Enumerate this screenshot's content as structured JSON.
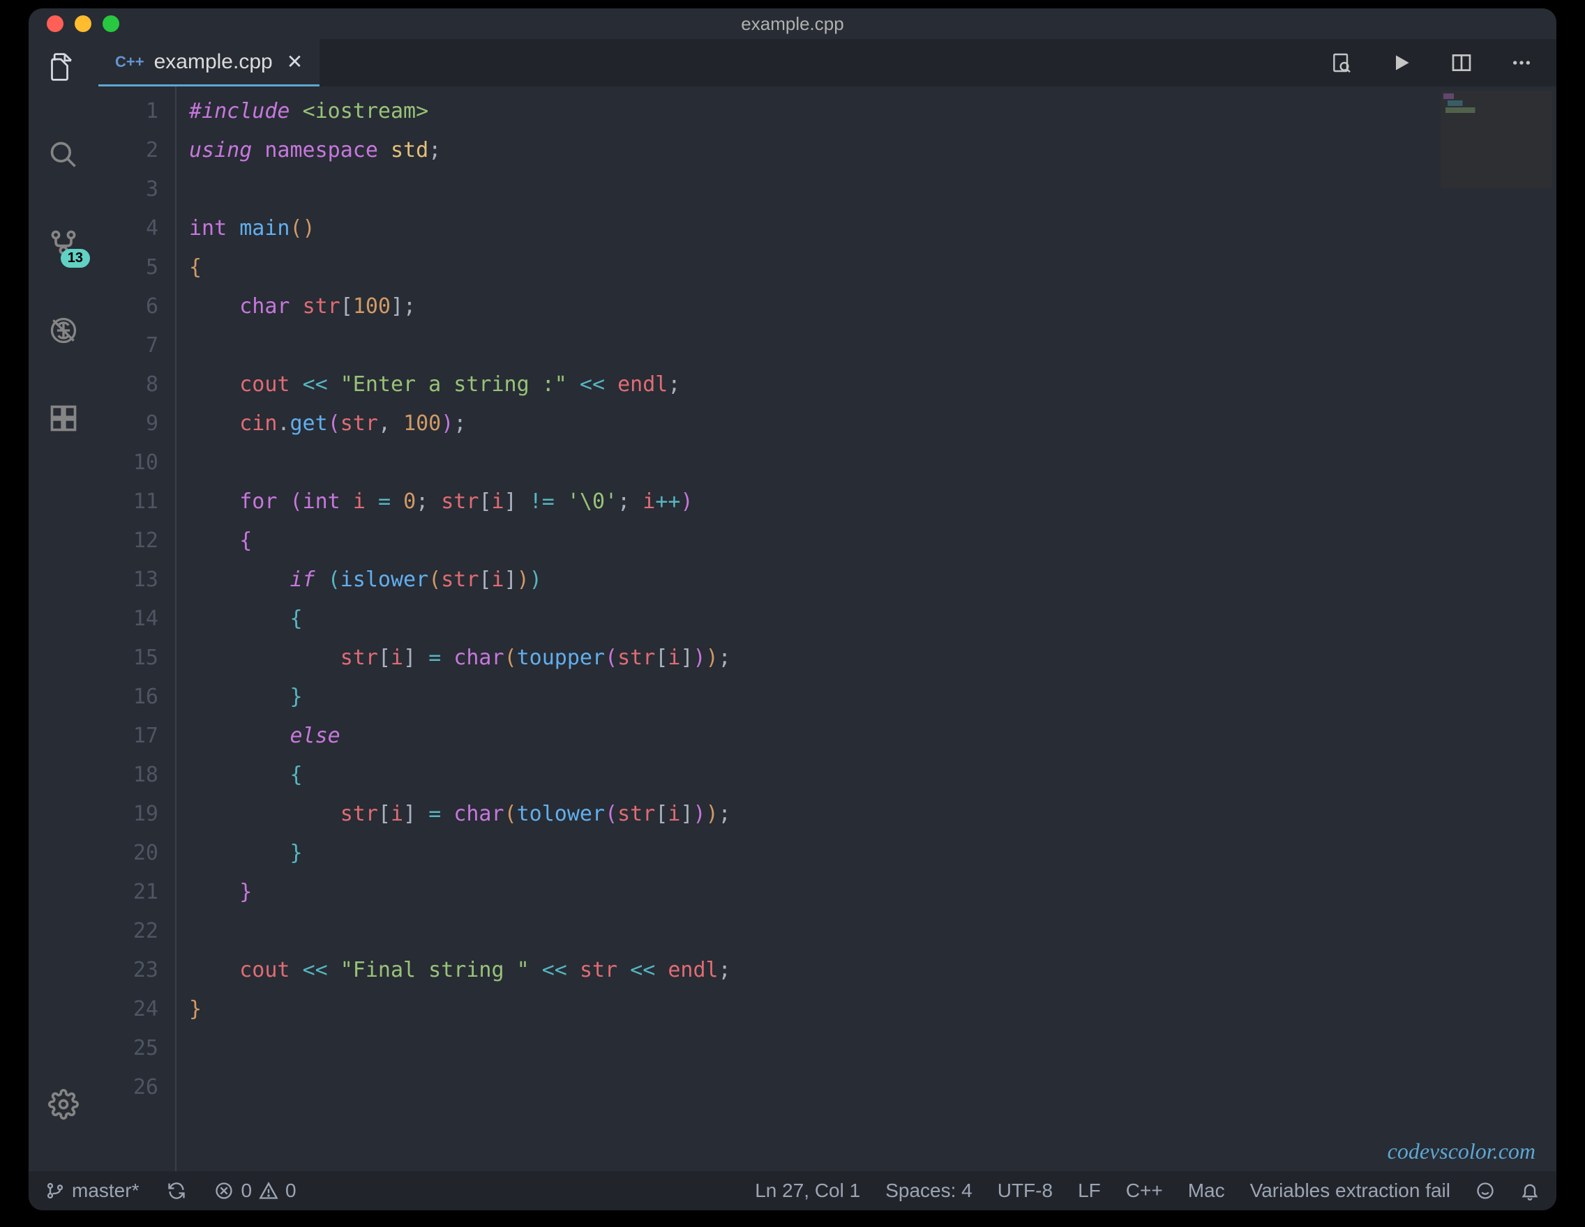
{
  "window": {
    "title": "example.cpp"
  },
  "tab": {
    "lang_icon": "C++",
    "filename": "example.cpp"
  },
  "activitybar": {
    "scm_badge": "13"
  },
  "code": {
    "lines": 26,
    "tokens": [
      [
        [
          "kw",
          "#include "
        ],
        [
          "inc",
          "<iostream>"
        ]
      ],
      [
        [
          "kw",
          "using "
        ],
        [
          "kw2",
          "namespace "
        ],
        [
          "ns",
          "std"
        ],
        [
          "punct",
          ";"
        ]
      ],
      [],
      [
        [
          "type",
          "int "
        ],
        [
          "fn",
          "main"
        ],
        [
          "brace1",
          "()"
        ]
      ],
      [
        [
          "brace1",
          "{"
        ]
      ],
      [
        [
          "punct",
          "    "
        ],
        [
          "type",
          "char "
        ],
        [
          "var",
          "str"
        ],
        [
          "punct",
          "["
        ],
        [
          "num",
          "100"
        ],
        [
          "punct",
          "];"
        ]
      ],
      [],
      [
        [
          "punct",
          "    "
        ],
        [
          "var",
          "cout"
        ],
        [
          "punct",
          " "
        ],
        [
          "op",
          "<<"
        ],
        [
          "punct",
          " "
        ],
        [
          "str",
          "\"Enter a string :\""
        ],
        [
          "punct",
          " "
        ],
        [
          "op",
          "<<"
        ],
        [
          "punct",
          " "
        ],
        [
          "var",
          "endl"
        ],
        [
          "punct",
          ";"
        ]
      ],
      [
        [
          "punct",
          "    "
        ],
        [
          "var",
          "cin"
        ],
        [
          "punct",
          "."
        ],
        [
          "fn",
          "get"
        ],
        [
          "brace2",
          "("
        ],
        [
          "var",
          "str"
        ],
        [
          "punct",
          ", "
        ],
        [
          "num",
          "100"
        ],
        [
          "brace2",
          ")"
        ],
        [
          "punct",
          ";"
        ]
      ],
      [],
      [
        [
          "punct",
          "    "
        ],
        [
          "kw2",
          "for "
        ],
        [
          "brace2",
          "("
        ],
        [
          "type",
          "int "
        ],
        [
          "var",
          "i"
        ],
        [
          "punct",
          " "
        ],
        [
          "op",
          "="
        ],
        [
          "punct",
          " "
        ],
        [
          "num",
          "0"
        ],
        [
          "punct",
          "; "
        ],
        [
          "var",
          "str"
        ],
        [
          "punct",
          "["
        ],
        [
          "var",
          "i"
        ],
        [
          "punct",
          "] "
        ],
        [
          "op",
          "!="
        ],
        [
          "punct",
          " "
        ],
        [
          "str",
          "'\\0'"
        ],
        [
          "punct",
          "; "
        ],
        [
          "var",
          "i"
        ],
        [
          "op",
          "++"
        ],
        [
          "brace2",
          ")"
        ]
      ],
      [
        [
          "punct",
          "    "
        ],
        [
          "brace2",
          "{"
        ]
      ],
      [
        [
          "punct",
          "        "
        ],
        [
          "kw",
          "if "
        ],
        [
          "brace3",
          "("
        ],
        [
          "fn",
          "islower"
        ],
        [
          "brace1",
          "("
        ],
        [
          "var",
          "str"
        ],
        [
          "punct",
          "["
        ],
        [
          "var",
          "i"
        ],
        [
          "punct",
          "]"
        ],
        [
          "brace1",
          ")"
        ],
        [
          "brace3",
          ")"
        ]
      ],
      [
        [
          "punct",
          "        "
        ],
        [
          "brace3",
          "{"
        ]
      ],
      [
        [
          "punct",
          "            "
        ],
        [
          "var",
          "str"
        ],
        [
          "punct",
          "["
        ],
        [
          "var",
          "i"
        ],
        [
          "punct",
          "] "
        ],
        [
          "op",
          "="
        ],
        [
          "punct",
          " "
        ],
        [
          "type",
          "char"
        ],
        [
          "brace1",
          "("
        ],
        [
          "fn",
          "toupper"
        ],
        [
          "brace2",
          "("
        ],
        [
          "var",
          "str"
        ],
        [
          "punct",
          "["
        ],
        [
          "var",
          "i"
        ],
        [
          "punct",
          "]"
        ],
        [
          "brace2",
          ")"
        ],
        [
          "brace1",
          ")"
        ],
        [
          "punct",
          ";"
        ]
      ],
      [
        [
          "punct",
          "        "
        ],
        [
          "brace3",
          "}"
        ]
      ],
      [
        [
          "punct",
          "        "
        ],
        [
          "kw",
          "else"
        ]
      ],
      [
        [
          "punct",
          "        "
        ],
        [
          "brace3",
          "{"
        ]
      ],
      [
        [
          "punct",
          "            "
        ],
        [
          "var",
          "str"
        ],
        [
          "punct",
          "["
        ],
        [
          "var",
          "i"
        ],
        [
          "punct",
          "] "
        ],
        [
          "op",
          "="
        ],
        [
          "punct",
          " "
        ],
        [
          "type",
          "char"
        ],
        [
          "brace1",
          "("
        ],
        [
          "fn",
          "tolower"
        ],
        [
          "brace2",
          "("
        ],
        [
          "var",
          "str"
        ],
        [
          "punct",
          "["
        ],
        [
          "var",
          "i"
        ],
        [
          "punct",
          "]"
        ],
        [
          "brace2",
          ")"
        ],
        [
          "brace1",
          ")"
        ],
        [
          "punct",
          ";"
        ]
      ],
      [
        [
          "punct",
          "        "
        ],
        [
          "brace3",
          "}"
        ]
      ],
      [
        [
          "punct",
          "    "
        ],
        [
          "brace2",
          "}"
        ]
      ],
      [],
      [
        [
          "punct",
          "    "
        ],
        [
          "var",
          "cout"
        ],
        [
          "punct",
          " "
        ],
        [
          "op",
          "<<"
        ],
        [
          "punct",
          " "
        ],
        [
          "str",
          "\"Final string \""
        ],
        [
          "punct",
          " "
        ],
        [
          "op",
          "<<"
        ],
        [
          "punct",
          " "
        ],
        [
          "var",
          "str"
        ],
        [
          "punct",
          " "
        ],
        [
          "op",
          "<<"
        ],
        [
          "punct",
          " "
        ],
        [
          "var",
          "endl"
        ],
        [
          "punct",
          ";"
        ]
      ],
      [
        [
          "brace1",
          "}"
        ]
      ],
      [],
      []
    ]
  },
  "watermark": "codevscolor.com",
  "statusbar": {
    "branch": "master*",
    "errors": "0",
    "warnings": "0",
    "cursor": "Ln 27, Col 1",
    "spaces": "Spaces: 4",
    "encoding": "UTF-8",
    "eol": "LF",
    "lang": "C++",
    "os": "Mac",
    "extra": "Variables extraction fail"
  }
}
